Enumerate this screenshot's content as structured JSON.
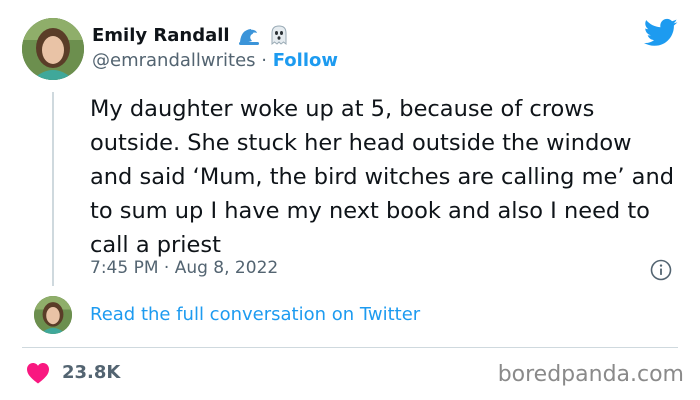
{
  "tweet": {
    "author": {
      "display_name": "Emily Randall",
      "handle": "@emrandallwrites",
      "separator": " · ",
      "follow_label": "Follow",
      "badges": [
        "wave-emoji-icon",
        "ghost-emoji-icon"
      ]
    },
    "text": "My daughter woke up at 5, because of crows outside. She stuck her head outside the window and said ‘Mum, the bird witches are calling me’ and to sum up I have my next book and also I need to call a priest",
    "timestamp": "7:45 PM · Aug 8, 2022",
    "conversation_link": "Read the full conversation on Twitter",
    "likes": "23.8K"
  },
  "watermark": "boredpanda.com",
  "colors": {
    "twitter_blue": "#1d9bf0",
    "text_primary": "#0f1419",
    "text_secondary": "#536471",
    "heart": "#f91880",
    "border": "#cfd9de"
  },
  "icons": [
    "twitter-bird-icon",
    "info-icon",
    "heart-icon",
    "wave-emoji-icon",
    "ghost-emoji-icon"
  ]
}
